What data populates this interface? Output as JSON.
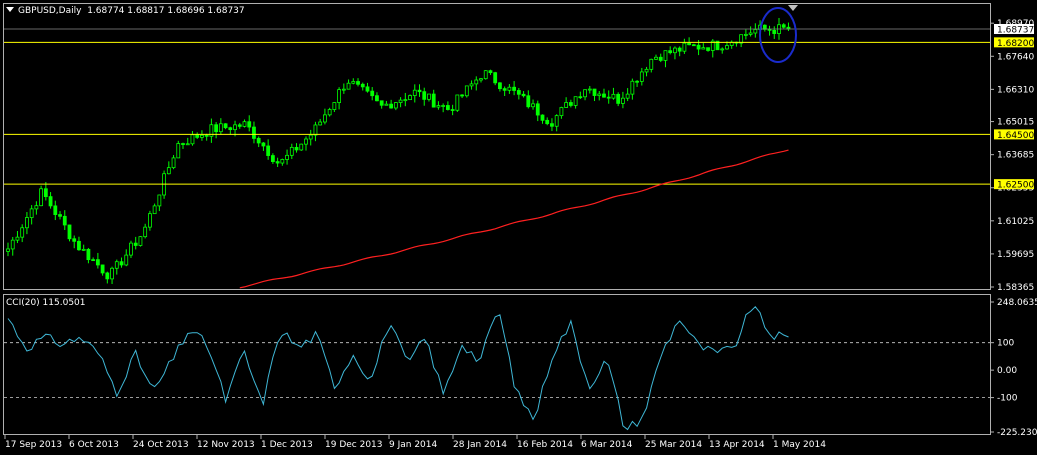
{
  "header": {
    "symbol": "GBPUSD,Daily",
    "ohlc": "1.68774 1.68817 1.68696 1.68737"
  },
  "indicator": {
    "label": "CCI(20) 115.0501"
  },
  "colors": {
    "background": "#000000",
    "frame": "#b0b0b0",
    "bull": "#00ff00",
    "bear": "#00ff00",
    "hline": "#ffff00",
    "price_tag_bg": "#ffff00",
    "ma": "#ff2020",
    "cci": "#3fb7d6",
    "highlight": "#1a2bcc"
  },
  "chart_data": [
    {
      "type": "candlestick",
      "series": [
        {
          "name": "GBPUSD,Daily",
          "kind": "ohlc_close_path",
          "x_dates": [
            "17 Sep 2013",
            "6 Oct 2013",
            "24 Oct 2013",
            "12 Nov 2013",
            "1 Dec 2013",
            "19 Dec 2013",
            "9 Jan 2014",
            "28 Jan 2014",
            "16 Feb 2014",
            "6 Mar 2014",
            "25 Mar 2014",
            "13 Apr 2014",
            "1 May 2014"
          ],
          "close_checkpoints": [
            1.599,
            1.622,
            1.601,
            1.588,
            1.606,
            1.641,
            1.647,
            1.649,
            1.633,
            1.646,
            1.667,
            1.656,
            1.662,
            1.655,
            1.67,
            1.661,
            1.65,
            1.664,
            1.659,
            1.676,
            1.68,
            1.681,
            1.687,
            1.6874
          ]
        },
        {
          "name": "MA",
          "kind": "moving_average",
          "x_start_index": 49,
          "start_value": 1.5836,
          "end_value": 1.639
        }
      ],
      "horizontal_lines": [
        1.682,
        1.645,
        1.625
      ],
      "current_price": 1.68737,
      "y_ticks": [
        1.6897,
        1.6764,
        1.6631,
        1.65015,
        1.63685,
        1.62355,
        1.61025,
        1.59695,
        1.58365
      ],
      "price_tags": [
        "1.68737",
        "1.68200",
        "1.64500",
        "1.62500"
      ],
      "ylim": [
        1.58365,
        1.6942
      ],
      "x_tick_labels": [
        "17 Sep 2013",
        "6 Oct 2013",
        "24 Oct 2013",
        "12 Nov 2013",
        "1 Dec 2013",
        "19 Dec 2013",
        "9 Jan 2014",
        "28 Jan 2014",
        "16 Feb 2014",
        "6 Mar 2014",
        "25 Mar 2014",
        "13 Apr 2014",
        "1 May 2014"
      ],
      "grid": false
    },
    {
      "type": "line",
      "series": [
        {
          "name": "CCI(20)",
          "checkpoints": [
            190,
            80,
            120,
            95,
            120,
            60,
            -80,
            60,
            -80,
            30,
            150,
            90,
            -110,
            70,
            -130,
            150,
            80,
            130,
            -60,
            60,
            -40,
            180,
            20,
            120,
            -90,
            100,
            30,
            230,
            -80,
            -180,
            60,
            170,
            -60,
            40,
            -220,
            -170,
            60,
            190,
            90,
            60,
            80,
            240,
            130,
            115
          ]
        }
      ],
      "y_ticks": [
        "248.0635",
        "100",
        "0.00",
        "-100",
        "-225.2301"
      ],
      "reference_lines": [
        100,
        -100
      ],
      "ylim": [
        -225.2301,
        248.0635
      ]
    }
  ],
  "axis": {
    "price_tick_labels": [
      "1.68970",
      "1.67640",
      "1.66310",
      "1.65015",
      "1.63685",
      "1.62355",
      "1.61025",
      "1.59695",
      "1.58365"
    ],
    "cci_tick_labels": [
      "248.0635",
      "100",
      "0.00",
      "-100",
      "-225.2301"
    ]
  }
}
